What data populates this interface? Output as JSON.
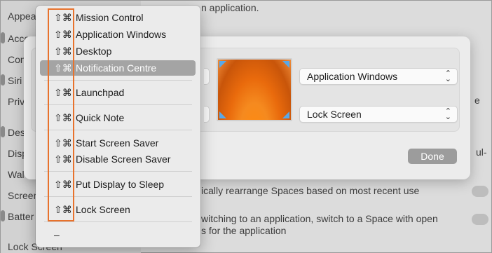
{
  "background": {
    "sidebar_items": [
      "Appea",
      "Access",
      "Con",
      "Siri",
      "Priv",
      "Des",
      "Disp",
      "Wal",
      "Screen",
      "Batter",
      "Lock Screen"
    ],
    "top_fragment": "n application.",
    "right_fragment_1": "e",
    "right_fragment_2": "ul-",
    "rearrange_text": "ically rearrange Spaces based on most recent use",
    "switch_text_1": "witching to an application, switch to a Space with open",
    "switch_text_2": "s for the application"
  },
  "sheet": {
    "top_right_value": "Application Windows",
    "bottom_right_value": "Lock Screen",
    "done_label": "Done"
  },
  "menu": {
    "mod_symbols": "⇧⌘",
    "items": [
      {
        "label": "Mission Control"
      },
      {
        "label": "Application Windows"
      },
      {
        "label": "Desktop"
      },
      {
        "label": "Notification Centre"
      },
      {
        "label": "Launchpad"
      },
      {
        "label": "Quick Note"
      },
      {
        "label": "Start Screen Saver"
      },
      {
        "label": "Disable Screen Saver"
      },
      {
        "label": "Put Display to Sleep"
      },
      {
        "label": "Lock Screen"
      }
    ],
    "none_label": "–",
    "selected_index": 3,
    "highlight_color": "#e8722c"
  }
}
